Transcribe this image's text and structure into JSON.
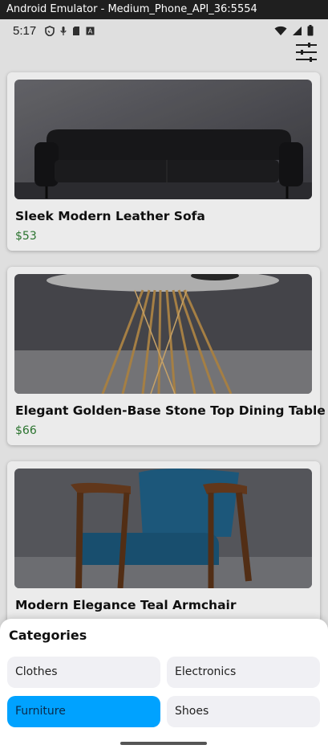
{
  "window": {
    "title": "Android Emulator - Medium_Phone_API_36:5554"
  },
  "status_bar": {
    "time": "5:17",
    "left_icons": [
      "shield-icon",
      "mic-icon",
      "sd-card-icon",
      "keyboard-icon"
    ],
    "right_icons": [
      "wifi-icon",
      "signal-icon",
      "battery-icon"
    ]
  },
  "toolbar": {
    "filter_icon": "sliders-icon"
  },
  "products": [
    {
      "title": "Sleek Modern Leather Sofa",
      "price": "$53",
      "image": "sofa"
    },
    {
      "title": "Elegant Golden-Base Stone Top Dining Table",
      "price": "$66",
      "image": "table"
    },
    {
      "title": "Modern Elegance Teal Armchair",
      "price": "",
      "image": "armchair"
    }
  ],
  "categories_sheet": {
    "title": "Categories",
    "options": [
      {
        "label": "Clothes",
        "selected": false
      },
      {
        "label": "Electronics",
        "selected": false
      },
      {
        "label": "Furniture",
        "selected": true
      },
      {
        "label": "Shoes",
        "selected": false
      }
    ],
    "accent_color": "#00a2ff"
  },
  "colors": {
    "price": "#2e7d32",
    "accent": "#00a2ff"
  }
}
